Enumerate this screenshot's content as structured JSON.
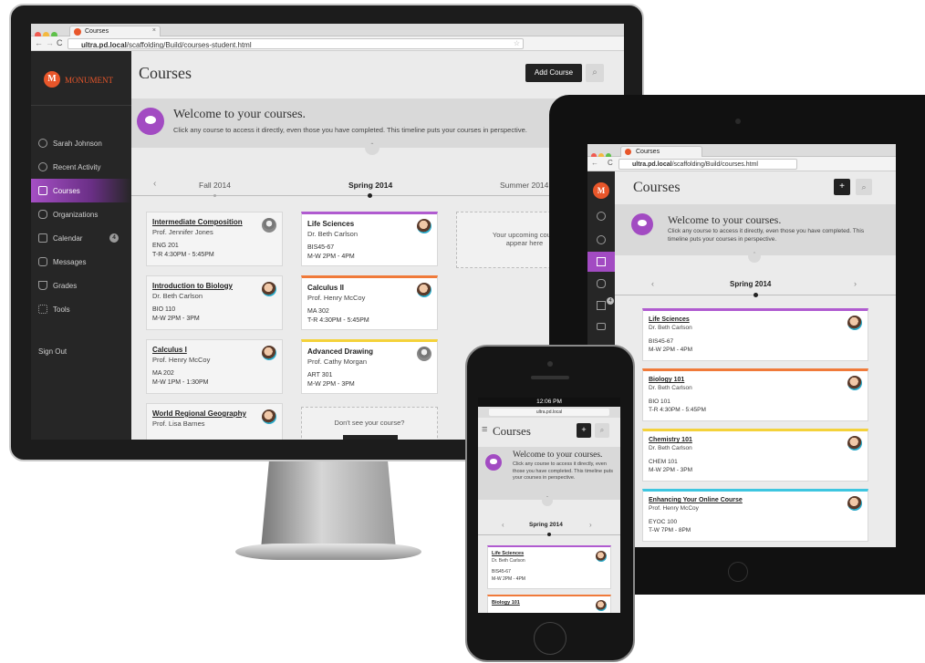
{
  "desktop": {
    "tab_title": "Courses",
    "url_bold": "ultra.pd.local",
    "url_rest": "/scaffolding/Build/courses-student.html",
    "brand": "MONUMENT",
    "brand_letter": "M",
    "nav": [
      {
        "label": "Sarah Johnson"
      },
      {
        "label": "Recent Activity"
      },
      {
        "label": "Courses"
      },
      {
        "label": "Organizations"
      },
      {
        "label": "Calendar",
        "badge": "4"
      },
      {
        "label": "Messages"
      },
      {
        "label": "Grades"
      },
      {
        "label": "Tools"
      }
    ],
    "sign_out": "Sign Out",
    "page_title": "Courses",
    "add_course": "Add Course",
    "welcome_title": "Welcome to your courses.",
    "welcome_text": "Click any course to access it directly, even those you have completed. This timeline puts your courses in perspective.",
    "terms": [
      "Fall 2014",
      "Spring 2014",
      "Summer 2014"
    ],
    "fall_courses": [
      {
        "title": "Intermediate Composition",
        "prof": "Prof. Jennifer Jones",
        "code": "ENG 201",
        "sched": "T-R 4:30PM - 5:45PM"
      },
      {
        "title": "Introduction to Biology",
        "prof": "Dr. Beth Carlson",
        "code": "BIO 110",
        "sched": "M-W 2PM - 3PM"
      },
      {
        "title": "Calculus I",
        "prof": "Prof. Henry McCoy",
        "code": "MA 202",
        "sched": "M-W 1PM - 1:30PM"
      },
      {
        "title": "World Regional Geography",
        "prof": "Prof. Lisa Barnes",
        "code": "",
        "sched": ""
      }
    ],
    "spring_courses": [
      {
        "title": "Life Sciences",
        "prof": "Dr. Beth Carlson",
        "code": "BIS45-67",
        "sched": "M-W 2PM - 4PM",
        "color": "#b05bd0"
      },
      {
        "title": "Calculus II",
        "prof": "Prof. Henry McCoy",
        "code": "MA 302",
        "sched": "T-R 4:30PM - 5:45PM",
        "color": "#f07a3a"
      },
      {
        "title": "Advanced Drawing",
        "prof": "Prof. Cathy Morgan",
        "code": "ART 301",
        "sched": "M-W 2PM - 3PM",
        "color": "#f4d23a"
      }
    ],
    "dont_see": "Don't see your course?",
    "upcoming_line1": "Your upcoming cours",
    "upcoming_line2": "appear here"
  },
  "tablet": {
    "tab_title": "Courses",
    "url_bold": "ultra.pd.local",
    "url_rest": "/scaffolding/Build/courses.html",
    "brand_letter": "M",
    "page_title": "Courses",
    "add_label": "+",
    "welcome_title": "Welcome to your courses.",
    "welcome_text": "Click any course to access it directly, even those you have completed. This timeline puts your courses in perspective.",
    "term": "Spring 2014",
    "prev": "‹",
    "next": "›",
    "courses": [
      {
        "title": "Life Sciences",
        "prof": "Dr. Beth Carlson",
        "code": "BIS45-67",
        "sched": "M-W 2PM - 4PM",
        "color": "#b05bd0"
      },
      {
        "title": "Biology 101",
        "prof": "Dr. Beth Carlson",
        "code": "BIO 101",
        "sched": "T-R 4:30PM - 5:45PM",
        "color": "#f07a3a"
      },
      {
        "title": "Chemistry 101",
        "prof": "Dr. Beth Carlson",
        "code": "CHEM 101",
        "sched": "M-W 2PM - 3PM",
        "color": "#f4d23a"
      },
      {
        "title": "Enhancing Your Online Course",
        "prof": "Prof. Henry McCoy",
        "code": "EYOC 100",
        "sched": "T-W 7PM - 8PM",
        "color": "#3ec6e0"
      }
    ],
    "calendar_badge": "4"
  },
  "phone": {
    "time": "12:06 PM",
    "url": "ultra.pd.local",
    "page_title": "Courses",
    "add_label": "+",
    "menu": "≡",
    "welcome_title": "Welcome to your courses.",
    "welcome_text": "Click any course to access it directly, even those you have completed. This timeline puts your courses in perspective.",
    "term": "Spring 2014",
    "prev": "‹",
    "next": "›",
    "courses": [
      {
        "title": "Life Sciences",
        "prof": "Dr. Beth Carlson",
        "code": "BIS45-67",
        "sched": "M-W 2PM - 4PM",
        "color": "#b05bd0"
      },
      {
        "title": "Biology 101",
        "prof": "",
        "code": "",
        "sched": "",
        "color": "#f07a3a"
      }
    ]
  },
  "colors": {
    "accent": "#a24bc2",
    "brand": "#e8562a"
  }
}
